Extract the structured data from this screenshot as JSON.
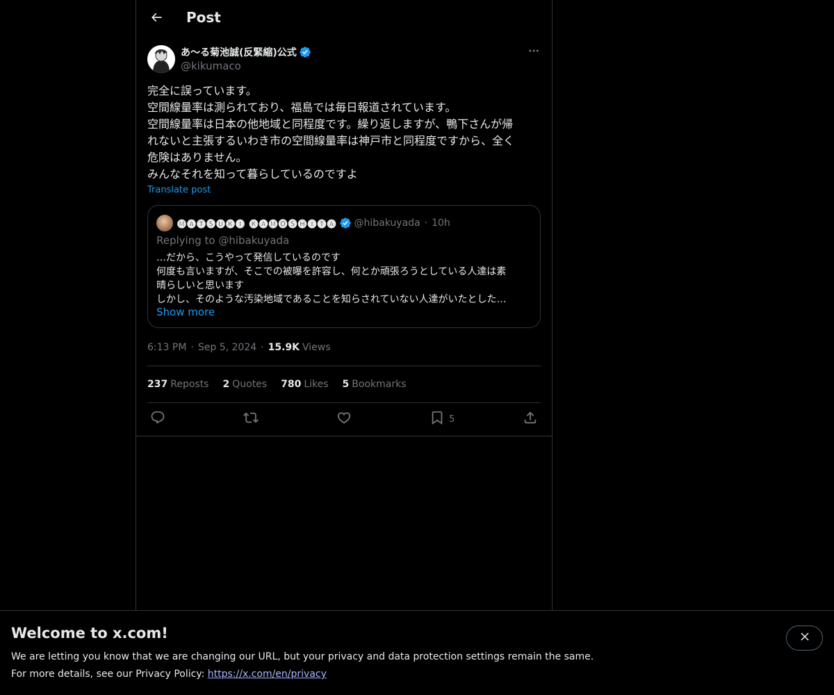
{
  "header": {
    "title": "Post"
  },
  "post": {
    "author": {
      "display_name": "あ〜る菊池誠(反緊縮)公式",
      "handle": "@kikumaco",
      "verified": true
    },
    "text_lines": [
      "完全に誤っています。",
      "空間線量率は測られており、福島では毎日報道されています。",
      "空間線量率は日本の他地域と同程度です。繰り返しますが、鴨下さんが帰",
      "れないと主張するいわき市の空間線量率は神戸市と同程度ですから、全く",
      "危険はありません。",
      "みんなそれを知って暮らしているのですよ"
    ],
    "translate_label": "Translate post",
    "quote": {
      "display_name": "🅜🅐🅣🅢🅤🅚🅘 🅚🅐🅜🅞🅢🅗🅘🅣🅐",
      "handle": "@hibakuyada",
      "time": "10h",
      "replying_to": "Replying to @hibakuyada",
      "text_lines": [
        "…だから、こうやって発信しているのです",
        "何度も言いますが、そこでの被曝を許容し、何とか頑張ろうとしている人達は素",
        "晴らしいと思います",
        "しかし、そのような汚染地域であることを知らされていない人達がいたとした…"
      ],
      "show_more": "Show more"
    },
    "meta": {
      "time": "6:13 PM",
      "date": "Sep 5, 2024",
      "views_count": "15.9K",
      "views_label": "Views"
    },
    "stats": {
      "reposts_count": "237",
      "reposts_label": "Reposts",
      "quotes_count": "2",
      "quotes_label": "Quotes",
      "likes_count": "780",
      "likes_label": "Likes",
      "bookmarks_count": "5",
      "bookmarks_label": "Bookmarks"
    },
    "actions": {
      "reply_icon": "reply-icon",
      "repost_icon": "repost-icon",
      "like_icon": "like-icon",
      "bookmark_icon": "bookmark-icon",
      "bookmark_count": "5",
      "share_icon": "share-icon"
    }
  },
  "banner": {
    "title": "Welcome to x.com!",
    "line1": "We are letting you know that we are changing our URL, but your privacy and data protection settings remain the same.",
    "line2_prefix": "For more details, see our Privacy Policy: ",
    "line2_link": "https://x.com/en/privacy"
  },
  "colors": {
    "background": "#000000",
    "text": "#e7e9ea",
    "muted": "#71767b",
    "accent": "#1d9bf0",
    "border": "#2f3336",
    "link": "#a9b5ff"
  }
}
